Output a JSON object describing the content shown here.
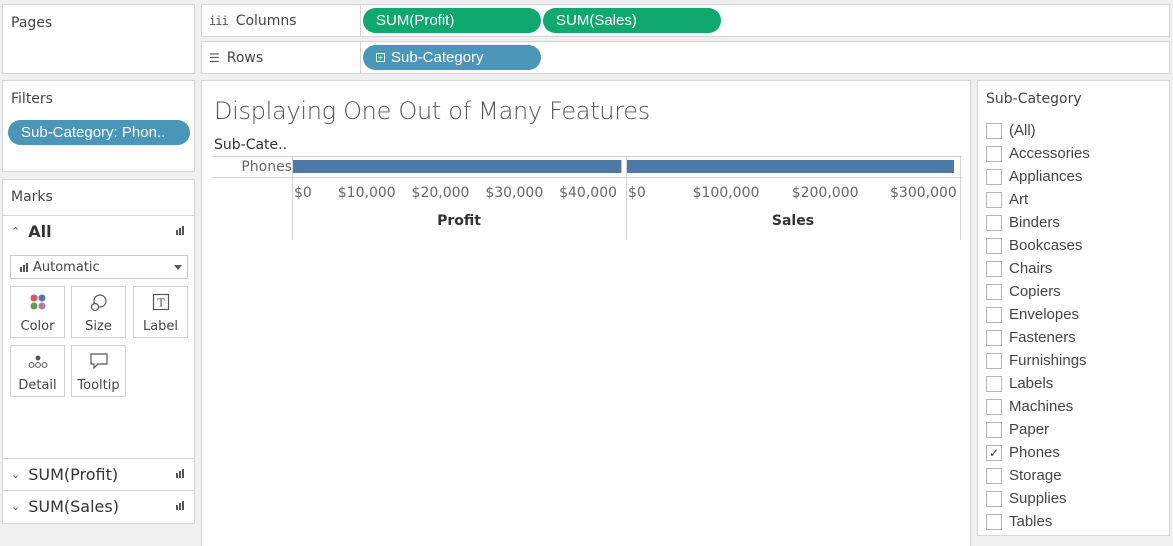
{
  "pages": {
    "title": "Pages"
  },
  "shelves": {
    "columns": {
      "label": "Columns",
      "icon": "iii",
      "pills": [
        "SUM(Profit)",
        "SUM(Sales)"
      ]
    },
    "rows": {
      "label": "Rows",
      "icon": "☰",
      "pills": [
        "Sub-Category"
      ]
    }
  },
  "filters": {
    "title": "Filters",
    "pill": "Sub-Category: Phon.."
  },
  "marks": {
    "title": "Marks",
    "all_label": "All",
    "mark_type": "Automatic",
    "buttons": {
      "color": "Color",
      "size": "Size",
      "label": "Label",
      "detail": "Detail",
      "tooltip": "Tooltip"
    },
    "measures": [
      "SUM(Profit)",
      "SUM(Sales)"
    ]
  },
  "view": {
    "title": "Displaying One Out of Many Features",
    "row_header": "Sub-Cate..",
    "row_label": "Phones"
  },
  "chart_data": {
    "type": "bar",
    "categories": [
      "Phones"
    ],
    "panes": [
      {
        "measure": "Profit",
        "value": 44516,
        "xlim": [
          0,
          45000
        ],
        "ticks": [
          0,
          10000,
          20000,
          30000,
          40000
        ],
        "tick_labels": [
          "$0",
          "$10,000",
          "$20,000",
          "$30,000",
          "$40,000"
        ]
      },
      {
        "measure": "Sales",
        "value": 330007,
        "xlim": [
          0,
          335000
        ],
        "ticks": [
          0,
          100000,
          200000,
          300000
        ],
        "tick_labels": [
          "$0",
          "$100,000",
          "$200,000",
          "$300,000"
        ]
      }
    ],
    "bar_color": "#4e79a7"
  },
  "filter_list": {
    "title": "Sub-Category",
    "items": [
      {
        "label": "(All)",
        "checked": false
      },
      {
        "label": "Accessories",
        "checked": false
      },
      {
        "label": "Appliances",
        "checked": false
      },
      {
        "label": "Art",
        "checked": false
      },
      {
        "label": "Binders",
        "checked": false
      },
      {
        "label": "Bookcases",
        "checked": false
      },
      {
        "label": "Chairs",
        "checked": false
      },
      {
        "label": "Copiers",
        "checked": false
      },
      {
        "label": "Envelopes",
        "checked": false
      },
      {
        "label": "Fasteners",
        "checked": false
      },
      {
        "label": "Furnishings",
        "checked": false
      },
      {
        "label": "Labels",
        "checked": false
      },
      {
        "label": "Machines",
        "checked": false
      },
      {
        "label": "Paper",
        "checked": false
      },
      {
        "label": "Phones",
        "checked": true
      },
      {
        "label": "Storage",
        "checked": false
      },
      {
        "label": "Supplies",
        "checked": false
      },
      {
        "label": "Tables",
        "checked": false
      }
    ]
  }
}
